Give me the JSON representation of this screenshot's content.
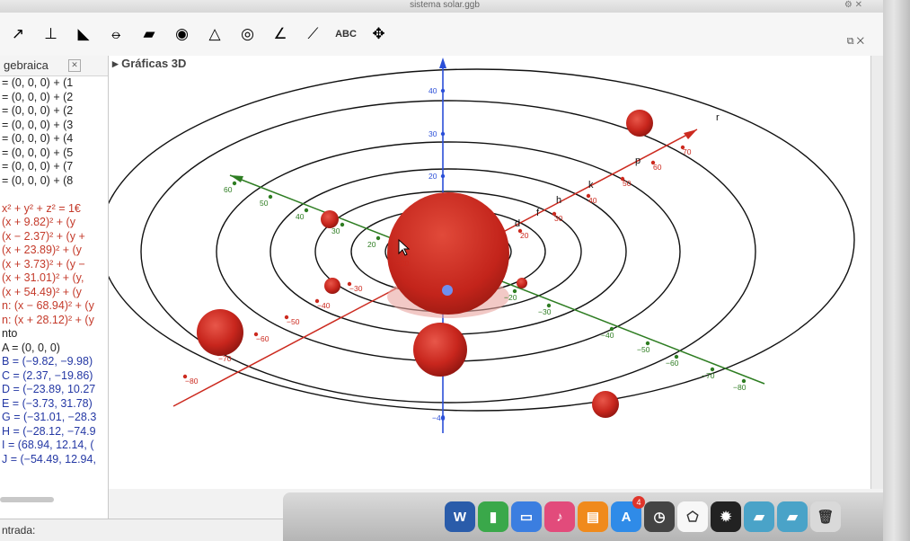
{
  "window": {
    "title": "sistema solar.ggb"
  },
  "toolbar": {
    "tools": [
      {
        "name": "line-tool-icon",
        "glyph": "↗"
      },
      {
        "name": "perpendicular-tool-icon",
        "glyph": "⊥"
      },
      {
        "name": "polygon-tool-icon",
        "glyph": "◣"
      },
      {
        "name": "circle-tool-icon",
        "glyph": "⦵"
      },
      {
        "name": "plane-tool-icon",
        "glyph": "▰"
      },
      {
        "name": "sphere-tool-icon",
        "glyph": "◉"
      },
      {
        "name": "pyramid-tool-icon",
        "glyph": "△"
      },
      {
        "name": "rotate-view-icon",
        "glyph": "◎"
      },
      {
        "name": "angle-tool-icon",
        "glyph": "∠"
      },
      {
        "name": "reflect-tool-icon",
        "glyph": "⟋"
      },
      {
        "name": "text-tool",
        "glyph": "ABC"
      },
      {
        "name": "move-view-icon",
        "glyph": "✥"
      }
    ]
  },
  "algebra": {
    "title": "gebraica",
    "rows": [
      {
        "text": "= (0, 0, 0) + (1",
        "color": "dark"
      },
      {
        "text": "= (0, 0, 0) + (2",
        "color": "dark"
      },
      {
        "text": "= (0, 0, 0) + (2",
        "color": "dark"
      },
      {
        "text": "= (0, 0, 0) + (3",
        "color": "dark"
      },
      {
        "text": "= (0, 0, 0) + (4",
        "color": "dark"
      },
      {
        "text": "= (0, 0, 0) + (5",
        "color": "dark"
      },
      {
        "text": "= (0, 0, 0) + (7",
        "color": "dark"
      },
      {
        "text": "= (0, 0, 0) + (8",
        "color": "dark"
      },
      {
        "text": "",
        "color": "dark"
      },
      {
        "text": "x² + y² + z² = 1€",
        "color": "red"
      },
      {
        "text": "(x + 9.82)² + (y",
        "color": "red"
      },
      {
        "text": "(x − 2.37)² + (y +",
        "color": "red"
      },
      {
        "text": "(x + 23.89)² + (y",
        "color": "red"
      },
      {
        "text": "(x + 3.73)² + (y −",
        "color": "red"
      },
      {
        "text": "(x + 31.01)² + (y,",
        "color": "red"
      },
      {
        "text": "(x + 54.49)² + (y",
        "color": "red"
      },
      {
        "text": "n: (x − 68.94)² + (y",
        "color": "red"
      },
      {
        "text": "n: (x + 28.12)² + (y",
        "color": "red"
      },
      {
        "text": "nto",
        "color": "dark"
      },
      {
        "text": "A = (0, 0, 0)",
        "color": "dark"
      },
      {
        "text": "B = (−9.82, −9.98)",
        "color": "blue"
      },
      {
        "text": "C = (2.37, −19.86)",
        "color": "blue"
      },
      {
        "text": "D = (−23.89, 10.27",
        "color": "blue"
      },
      {
        "text": "E = (−3.73, 31.78)",
        "color": "blue"
      },
      {
        "text": "G = (−31.01, −28.3",
        "color": "blue"
      },
      {
        "text": "H = (−28.12, −74.9",
        "color": "blue"
      },
      {
        "text": "I = (68.94, 12.14, (",
        "color": "blue"
      },
      {
        "text": "J = (−54.49, 12.94,",
        "color": "blue"
      }
    ]
  },
  "graphics3d": {
    "title": "Gráficas 3D",
    "curve_labels": [
      "d",
      "f",
      "h",
      "k",
      "p",
      "r"
    ],
    "x_axis_ticks": [
      "70",
      "60",
      "50",
      "40",
      "30",
      "20",
      "−20",
      "−30",
      "−40",
      "−50",
      "−60",
      "−70",
      "−80"
    ],
    "y_axis_ticks": [
      "60",
      "50",
      "40",
      "30",
      "20",
      "−20",
      "−30",
      "−40",
      "−50",
      "−60",
      "−70",
      "−80",
      "−90"
    ],
    "z_axis_ticks": [
      "40",
      "30",
      "20",
      "−40"
    ],
    "colors": {
      "planet": "#c8261d",
      "x_axis": "#cc2a1f",
      "y_axis": "#2e7d22",
      "z_axis": "#2b4fd8",
      "orbit": "#111111"
    }
  },
  "input_bar": {
    "label": "ntrada:"
  },
  "dock": {
    "apps": [
      {
        "name": "word-icon",
        "glyph": "W",
        "color": "#2a5caa"
      },
      {
        "name": "numbers-icon",
        "glyph": "▮",
        "color": "#3aa84a"
      },
      {
        "name": "keynote-icon",
        "glyph": "▭",
        "color": "#3b7ee0"
      },
      {
        "name": "itunes-icon",
        "glyph": "♪",
        "color": "#e24b7b"
      },
      {
        "name": "ibooks-icon",
        "glyph": "▤",
        "color": "#f08a1c"
      },
      {
        "name": "app-store-icon",
        "glyph": "A",
        "color": "#2f8be8"
      },
      {
        "name": "time-machine-icon",
        "glyph": "◷",
        "color": "#444444"
      },
      {
        "name": "geogebra-icon",
        "glyph": "⬠",
        "color": "#f7f7f7"
      },
      {
        "name": "settings-icon",
        "glyph": "✹",
        "color": "#222222"
      },
      {
        "name": "folder-icon",
        "glyph": "▰",
        "color": "#4aa3c8"
      },
      {
        "name": "downloads-folder-icon",
        "glyph": "▰",
        "color": "#4aa3c8"
      },
      {
        "name": "trash-icon",
        "glyph": "🗑",
        "color": "#d9d9d9"
      }
    ],
    "badge": "4"
  }
}
